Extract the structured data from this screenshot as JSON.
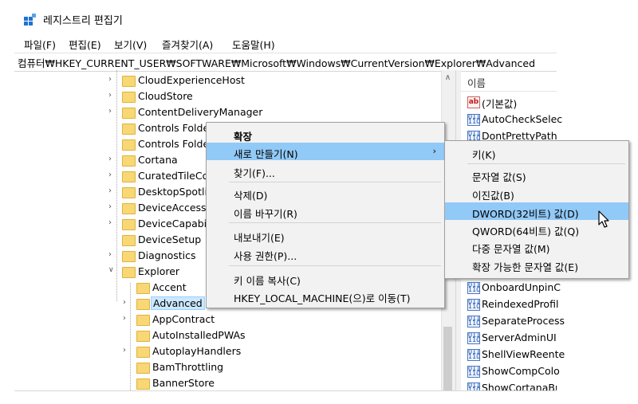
{
  "window": {
    "title": "레지스트리 편집기",
    "icon": "registry-editor-icon"
  },
  "menubar": {
    "items": [
      "파일(F)",
      "편집(E)",
      "보기(V)",
      "즐겨찾기(A)",
      "도움말(H)"
    ]
  },
  "address": "컴퓨터₩HKEY_CURRENT_USER₩SOFTWARE₩Microsoft₩Windows₩CurrentVersion₩Explorer₩Advanced",
  "tree": {
    "items": [
      {
        "label": "CloudExperienceHost",
        "expander": "collapsed"
      },
      {
        "label": "CloudStore",
        "expander": "collapsed"
      },
      {
        "label": "ContentDeliveryManager",
        "expander": "collapsed"
      },
      {
        "label": "Controls Folde",
        "expander": "none"
      },
      {
        "label": "Controls Folde",
        "expander": "none"
      },
      {
        "label": "Cortana",
        "expander": "collapsed"
      },
      {
        "label": "CuratedTileCo",
        "expander": "collapsed"
      },
      {
        "label": "DesktopSpotli",
        "expander": "collapsed"
      },
      {
        "label": "DeviceAccess",
        "expander": "collapsed"
      },
      {
        "label": "DeviceCapabil",
        "expander": "collapsed"
      },
      {
        "label": "DeviceSetup",
        "expander": "none"
      },
      {
        "label": "Diagnostics",
        "expander": "collapsed"
      },
      {
        "label": "Explorer",
        "expander": "expanded"
      },
      {
        "label": "Accent",
        "expander": "none"
      },
      {
        "label": "Advanced",
        "expander": "collapsed",
        "selected": true
      },
      {
        "label": "AppContract",
        "expander": "collapsed"
      },
      {
        "label": "AutoInstalledPWAs",
        "expander": "none"
      },
      {
        "label": "AutoplayHandlers",
        "expander": "collapsed"
      },
      {
        "label": "BamThrottling",
        "expander": "none"
      },
      {
        "label": "BannerStore",
        "expander": "none"
      }
    ]
  },
  "values_pane": {
    "column_name": "이름",
    "top_items": [
      {
        "label": "(기본값)",
        "type": "string"
      },
      {
        "label": "AutoCheckSelec",
        "type": "dword"
      },
      {
        "label": "DontPrettyPath",
        "type": "dword"
      }
    ],
    "bottom_items": [
      {
        "label": "OnboardUnpinC",
        "type": "dword"
      },
      {
        "label": "ReindexedProfil",
        "type": "dword"
      },
      {
        "label": "SeparateProcess",
        "type": "dword"
      },
      {
        "label": "ServerAdminUI",
        "type": "dword"
      },
      {
        "label": "ShellViewReente",
        "type": "dword"
      },
      {
        "label": "ShowCompColo",
        "type": "dword"
      },
      {
        "label": "ShowCortanaBu",
        "type": "dword"
      }
    ]
  },
  "context_menu": {
    "expand": "확장",
    "new": "새로 만들기(N)",
    "find": "찾기(F)...",
    "delete": "삭제(D)",
    "rename": "이름 바꾸기(R)",
    "export": "내보내기(E)",
    "permissions": "사용 권한(P)...",
    "copy_key_name": "키 이름 복사(C)",
    "goto_hklm": "HKEY_LOCAL_MACHINE(으)로 이동(T)"
  },
  "submenu": {
    "key": "키(K)",
    "string_value": "문자열 값(S)",
    "binary_value": "이진값(B)",
    "dword_value": "DWORD(32비트) 값(D)",
    "qword_value": "QWORD(64비트) 값(Q)",
    "multi_string_value": "다중 문자열 값(M)",
    "expandable_string_value": "확장 가능한 문자열 값(E)"
  },
  "colors": {
    "menu_highlight": "#91c9f7",
    "selection": "#cce8ff",
    "folder": "#f8d775"
  }
}
